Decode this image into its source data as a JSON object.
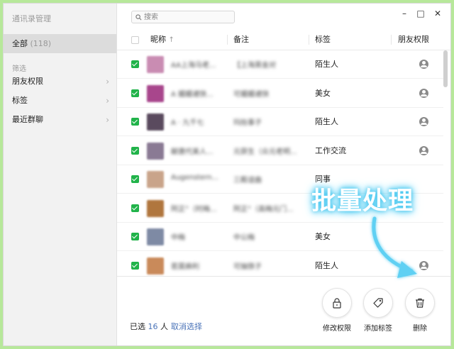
{
  "app_title": "通讯录管理",
  "search": {
    "placeholder": "搜索"
  },
  "window_controls": {
    "minimize": "–",
    "maximize": "□",
    "close": "✕"
  },
  "sidebar": {
    "all_label": "全部",
    "all_count": "(118)",
    "filter_label": "筛选",
    "items": [
      {
        "label": "朋友权限",
        "chevron": "›"
      },
      {
        "label": "标签",
        "chevron": "›"
      },
      {
        "label": "最近群聊",
        "chevron": "›"
      }
    ]
  },
  "table": {
    "columns": {
      "nickname": "昵称",
      "sort_indicator": "↑",
      "remark": "备注",
      "tag": "标签",
      "permission": "朋友权限"
    },
    "rows": [
      {
        "checked": true,
        "nickname": "AA上海马老...",
        "remark": "【上海英金对",
        "tag": "陌生人",
        "perm_icon": "user-icon",
        "avatar_color": "#c98cb2"
      },
      {
        "checked": true,
        "nickname": "A 媚媚诸快...",
        "remark": "可媚媚诸快",
        "tag": "美女",
        "perm_icon": "user-icon",
        "avatar_color": "#a8468c"
      },
      {
        "checked": true,
        "nickname": "A · 九千七",
        "remark": "玛抬事子",
        "tag": "陌生人",
        "perm_icon": "user-icon",
        "avatar_color": "#5a4a5e"
      },
      {
        "checked": true,
        "nickname": "献唐代美人...",
        "remark": "元获生（众元老明...",
        "tag": "工作交流",
        "perm_icon": "user-icon",
        "avatar_color": "#8a7a94"
      },
      {
        "checked": true,
        "nickname": "Augenstern...",
        "remark": "三殿谊曲",
        "tag": "同事",
        "perm_icon": "",
        "avatar_color": "#c9a48a"
      },
      {
        "checked": true,
        "nickname": "阿正°（时梅...",
        "remark": "阿正°（高梅元门...",
        "tag": "",
        "perm_icon": "",
        "avatar_color": "#b0763e"
      },
      {
        "checked": true,
        "nickname": "中梅",
        "remark": "中公梅",
        "tag": "美女",
        "perm_icon": "",
        "avatar_color": "#7e8aa4"
      },
      {
        "checked": true,
        "nickname": "若莫麻利",
        "remark": "可抽铁子",
        "tag": "陌生人",
        "perm_icon": "user-icon",
        "avatar_color": "#c98a5a"
      }
    ]
  },
  "footer": {
    "selected_prefix": "已选",
    "selected_count": "16",
    "selected_suffix": "人",
    "deselect_label": "取消选择",
    "actions": [
      {
        "label": "修改权限",
        "icon": "lock-icon"
      },
      {
        "label": "添加标签",
        "icon": "tag-icon"
      },
      {
        "label": "删除",
        "icon": "trash-icon"
      }
    ]
  },
  "overlay": {
    "title": "批量处理",
    "color": "#49c8f0"
  },
  "colors": {
    "check_green": "#21b34a",
    "link_blue": "#4a73b8",
    "background": "#b7e89a"
  }
}
